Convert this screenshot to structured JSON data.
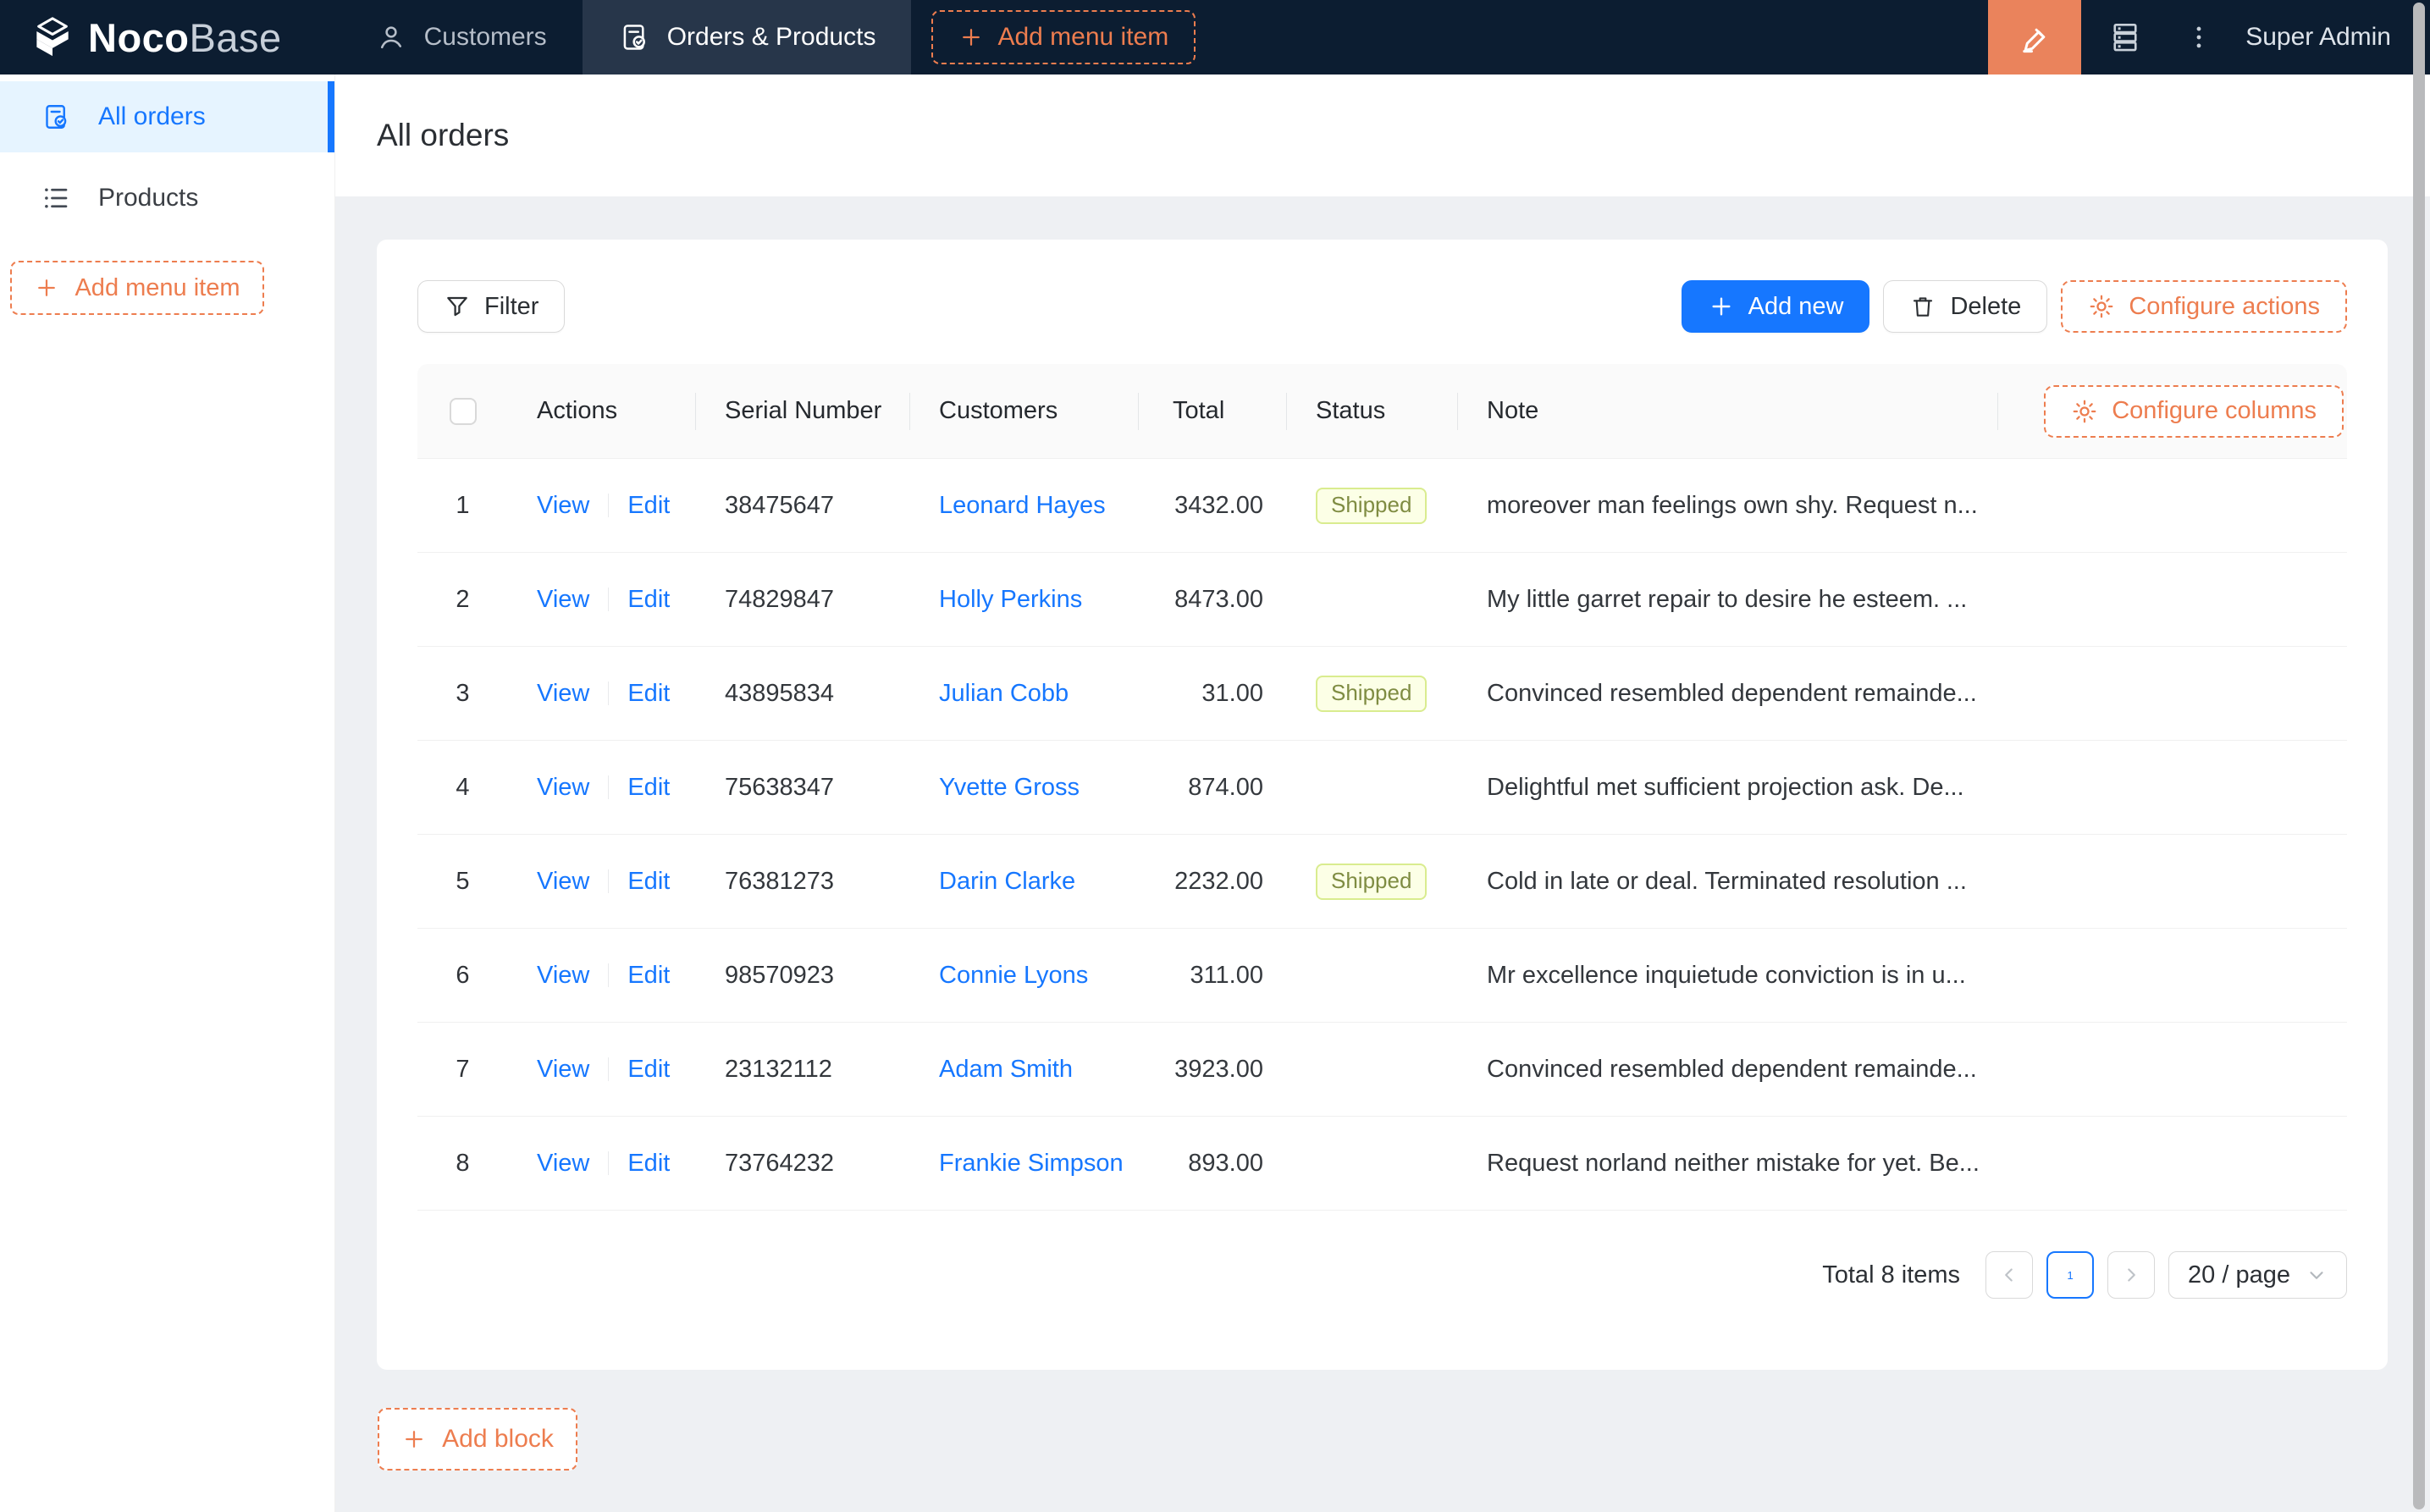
{
  "navbar": {
    "logo": {
      "bold": "Noco",
      "light": "Base"
    },
    "tabs": [
      {
        "label": "Customers",
        "icon": "person-icon",
        "active": false
      },
      {
        "label": "Orders & Products",
        "icon": "clipboard-check-icon",
        "active": true
      }
    ],
    "add_menu_item_label": "Add menu item",
    "user": "Super Admin"
  },
  "sidebar": {
    "items": [
      {
        "label": "All orders",
        "icon": "clipboard-check-icon",
        "active": true
      },
      {
        "label": "Products",
        "icon": "list-icon",
        "active": false
      }
    ],
    "add_menu_item_label": "Add menu item"
  },
  "page": {
    "title": "All orders"
  },
  "toolbar": {
    "filter_label": "Filter",
    "add_new_label": "Add new",
    "delete_label": "Delete",
    "configure_actions_label": "Configure actions"
  },
  "table": {
    "columns": [
      "Actions",
      "Serial Number",
      "Customers",
      "Total",
      "Status",
      "Note"
    ],
    "configure_columns_label": "Configure columns",
    "actions": {
      "view": "View",
      "edit": "Edit"
    },
    "rows": [
      {
        "index": "1",
        "serial": "38475647",
        "customer": "Leonard Hayes",
        "total": "3432.00",
        "status": "Shipped",
        "note": "moreover man feelings own shy. Request n..."
      },
      {
        "index": "2",
        "serial": "74829847",
        "customer": "Holly Perkins",
        "total": "8473.00",
        "status": "",
        "note": "My little garret repair to desire he esteem. ..."
      },
      {
        "index": "3",
        "serial": "43895834",
        "customer": "Julian Cobb",
        "total": "31.00",
        "status": "Shipped",
        "note": "Convinced resembled dependent remainde..."
      },
      {
        "index": "4",
        "serial": "75638347",
        "customer": "Yvette Gross",
        "total": "874.00",
        "status": "",
        "note": "Delightful met sufficient projection ask. De..."
      },
      {
        "index": "5",
        "serial": "76381273",
        "customer": "Darin Clarke",
        "total": "2232.00",
        "status": "Shipped",
        "note": "Cold in late or deal. Terminated resolution ..."
      },
      {
        "index": "6",
        "serial": "98570923",
        "customer": "Connie Lyons",
        "total": "311.00",
        "status": "",
        "note": "Mr excellence inquietude conviction is in u..."
      },
      {
        "index": "7",
        "serial": "23132112",
        "customer": "Adam Smith",
        "total": "3923.00",
        "status": "",
        "note": "Convinced resembled dependent remainde..."
      },
      {
        "index": "8",
        "serial": "73764232",
        "customer": "Frankie Simpson",
        "total": "893.00",
        "status": "",
        "note": "Request norland neither mistake for yet. Be..."
      }
    ],
    "pagination": {
      "total_text": "Total 8 items",
      "current_page": "1",
      "page_size_label": "20 / page"
    }
  },
  "footer": {
    "add_block_label": "Add block"
  },
  "icons": [
    "cube-logo-icon",
    "person-icon",
    "clipboard-check-icon",
    "plus-icon",
    "highlighter-icon",
    "plugin-server-icon",
    "kebab-icon",
    "list-icon",
    "filter-icon",
    "trash-icon",
    "gear-icon",
    "chevron-left-icon",
    "chevron-right-icon",
    "chevron-down-icon"
  ],
  "colors": {
    "navbar_bg": "#0c1d31",
    "active_tab_bg": "#27364a",
    "primary_blue": "#1677ff",
    "accent_orange": "#ed7d4f",
    "ui_editor_bg": "#ea835c",
    "sidebar_active_bg": "#e6f4ff",
    "content_bg": "#eef0f3",
    "table_header_bg": "#fafafa",
    "status_bg": "#fcffe6",
    "status_border": "#d9ec8f",
    "status_text": "#7f8c42"
  }
}
